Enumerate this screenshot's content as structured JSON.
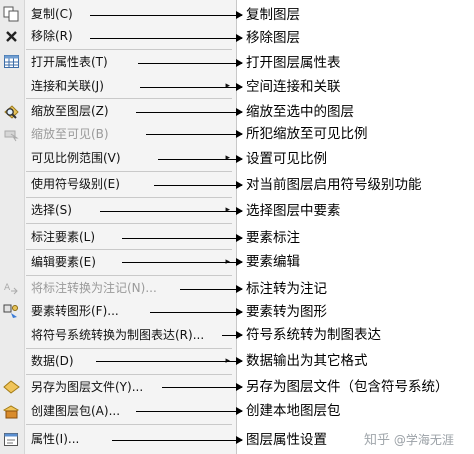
{
  "menu": {
    "items": [
      {
        "label": "复制(C)",
        "icon": "copy-icon"
      },
      {
        "label": "移除(R)",
        "icon": "remove-x-icon"
      },
      {
        "label": "打开属性表(T)",
        "icon": "table-icon"
      },
      {
        "label": "连接和关联(J)",
        "icon": ""
      },
      {
        "label": "缩放至图层(Z)",
        "icon": "zoom-to-layer-icon"
      },
      {
        "label": "缩放至可见(B)",
        "icon": "zoom-to-visible-icon"
      },
      {
        "label": "可见比例范围(V)",
        "icon": ""
      },
      {
        "label": "使用符号级别(E)",
        "icon": ""
      },
      {
        "label": "选择(S)",
        "icon": ""
      },
      {
        "label": "标注要素(L)",
        "icon": ""
      },
      {
        "label": "编辑要素(E)",
        "icon": ""
      },
      {
        "label": "将标注转换为注记(N)...",
        "icon": "label-to-annotation-icon"
      },
      {
        "label": "要素转图形(F)...",
        "icon": "feature-to-graphic-icon"
      },
      {
        "label": "将符号系统转换为制图表达(R)...",
        "icon": ""
      },
      {
        "label": "数据(D)",
        "icon": ""
      },
      {
        "label": "另存为图层文件(Y)...",
        "icon": "save-layer-file-icon"
      },
      {
        "label": "创建图层包(A)...",
        "icon": "layer-package-icon"
      },
      {
        "label": "属性(I)...",
        "icon": "properties-icon"
      }
    ],
    "submenu_glyph": "▸"
  },
  "annotations": [
    "复制图层",
    "移除图层",
    "打开图层属性表",
    "空间连接和关联",
    "缩放至选中的图层",
    "所犯缩放至可见比例",
    "设置可见比例",
    "对当前图层启用符号级别功能",
    "选择图层中要素",
    "要素标注",
    "要素编辑",
    "标注转为注记",
    "要素转为图形",
    "符号系统转为制图表达",
    "数据输出为其它格式",
    "另存为图层文件（包含符号系统）",
    "创建本地图层包",
    "图层属性设置"
  ],
  "watermark": {
    "zh": "知乎",
    "handle": "@学海无涯"
  },
  "colors": {
    "menu_bg": "#f4f4f4",
    "disabled_text": "#9a9a9a",
    "arrow": "#000000"
  }
}
